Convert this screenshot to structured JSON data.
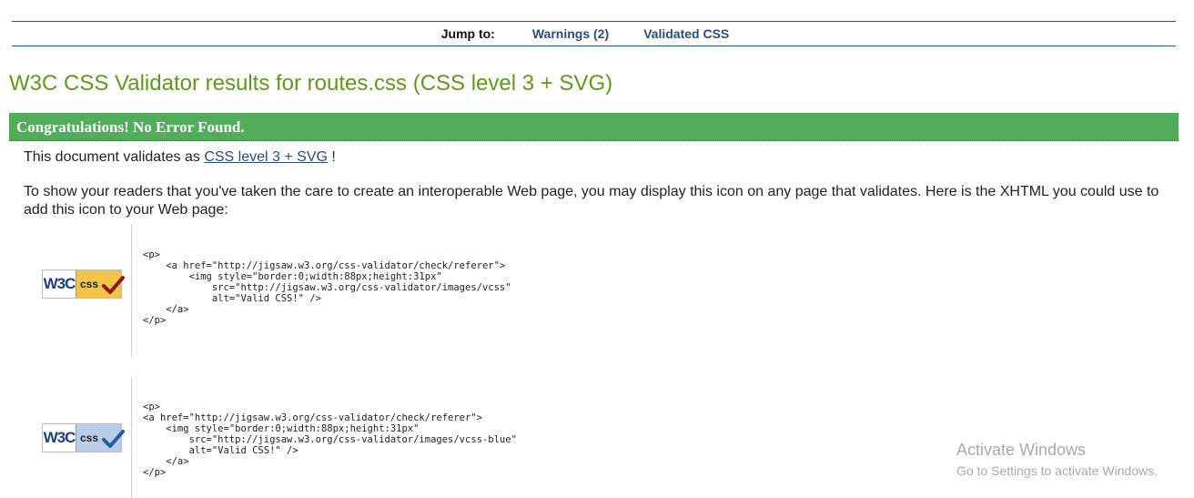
{
  "jump": {
    "label": "Jump to:",
    "links": [
      "Warnings (2)",
      "Validated CSS"
    ]
  },
  "title": "W3C CSS Validator results for routes.css (CSS level 3 + SVG)",
  "banner": "Congratulations! No Error Found.",
  "validates": {
    "prefix": "This document validates as ",
    "link": "CSS level 3 + SVG",
    "suffix": " !"
  },
  "explain": "To show your readers that you've taken the care to create an interoperable Web page, you may display this icon on any page that validates. Here is the XHTML you could use to add this icon to your Web page:",
  "badges": [
    {
      "w3c": "W3C",
      "css": "css",
      "check_color": "#8b1a1a",
      "code": "<p>\n    <a href=\"http://jigsaw.w3.org/css-validator/check/referer\">\n        <img style=\"border:0;width:88px;height:31px\"\n            src=\"http://jigsaw.w3.org/css-validator/images/vcss\"\n            alt=\"Valid CSS!\" />\n    </a>\n</p>"
    },
    {
      "w3c": "W3C",
      "css": "css",
      "check_color": "#1f5fa8",
      "code": "<p>\n<a href=\"http://jigsaw.w3.org/css-validator/check/referer\">\n    <img style=\"border:0;width:88px;height:31px\"\n        src=\"http://jigsaw.w3.org/css-validator/images/vcss-blue\"\n        alt=\"Valid CSS!\" />\n    </a>\n</p>"
    }
  ],
  "watermark": {
    "line1": "Activate Windows",
    "line2": "Go to Settings to activate Windows."
  },
  "colors": {
    "title": "#5f9a16",
    "banner": "#52ad5b",
    "link": "#2a4c82"
  }
}
